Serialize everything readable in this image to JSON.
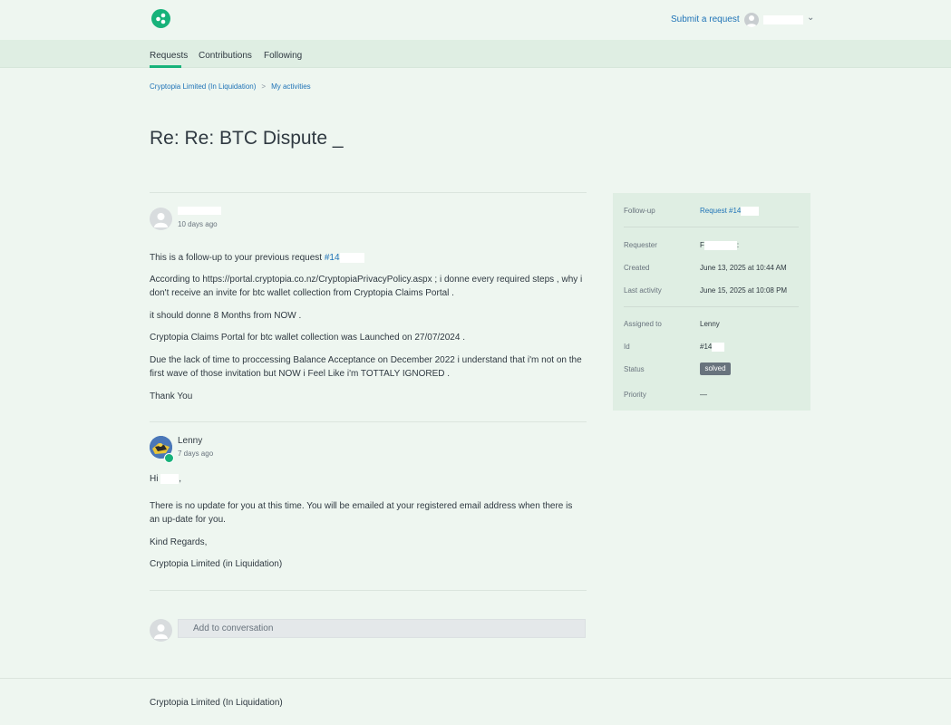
{
  "header": {
    "submit_label": "Submit a request",
    "user_name": ""
  },
  "nav": {
    "tabs": [
      {
        "label": "Requests",
        "active": true
      },
      {
        "label": "Contributions",
        "active": false
      },
      {
        "label": "Following",
        "active": false
      }
    ]
  },
  "breadcrumb": {
    "items": [
      "Cryptopia Limited (In Liquidation)",
      "My activities"
    ],
    "separator": ">"
  },
  "page": {
    "title": "Re: Re: BTC Dispute _"
  },
  "comments": [
    {
      "author": "",
      "time": "10 days ago",
      "paragraphs": [
        "This is a follow-up to your previous request ",
        "According to https://portal.cryptopia.co.nz/CryptopiaPrivacyPolicy.aspx ; i donne every required steps , why i don't receive an invite for btc wallet collection from Cryptopia Claims Portal .",
        "it should donne 8 Months from NOW .",
        "Cryptopia Claims Portal for btc wallet collection was Launched on 27/07/2024 .",
        "Due the lack of time to proccessing Balance Acceptance on December 2022 i understand that i'm not on the first wave of those invitation but NOW i Feel Like i'm TOTTALY IGNORED .",
        "Thank You"
      ],
      "request_link": "#14"
    },
    {
      "author": "Lenny",
      "time": "7 days ago",
      "paragraphs": [
        "Hi",
        ",",
        "There is no update for you at this time. You will be emailed at your registered email address when there is an up-date for you.",
        "Kind Regards,",
        "Cryptopia Limited (in Liquidation)"
      ]
    }
  ],
  "composer": {
    "placeholder": "Add to conversation"
  },
  "sidebar": {
    "followup_label": "Follow-up",
    "followup_value": "Request #14",
    "requester_label": "Requester",
    "requester_value": "F",
    "requester_suffix": ":",
    "created_label": "Created",
    "created_value": "June 13, 2025 at 10:44 AM",
    "last_activity_label": "Last activity",
    "last_activity_value": "June 15, 2025 at 10:08 PM",
    "assigned_label": "Assigned to",
    "assigned_value": "Lenny",
    "id_label": "Id",
    "id_value": "#14",
    "status_label": "Status",
    "status_value": "solved",
    "priority_label": "Priority",
    "priority_value": "—"
  },
  "footer": {
    "text": "Cryptopia Limited (In Liquidation)"
  },
  "colors": {
    "background": "#eef6f0",
    "brand_green": "#17b27a",
    "link_blue": "#1f73b7",
    "sidebar_bg": "#dfeee3",
    "status_badge": "#68737d"
  }
}
